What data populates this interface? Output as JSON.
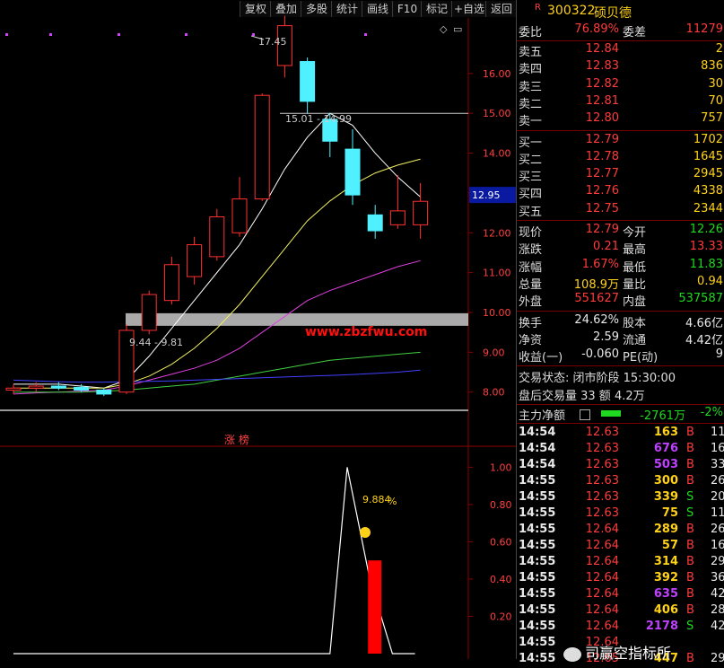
{
  "toolbar": [
    "复权",
    "叠加",
    "多股",
    "统计",
    "画线",
    "F10",
    "标记",
    "+自选",
    "返回"
  ],
  "header": {
    "badge": "R",
    "code": "300322",
    "name": "硕贝德"
  },
  "chart": {
    "price_axis": [
      "16.00",
      "15.00",
      "14.00",
      "13.00",
      "12.00",
      "11.00",
      "10.00",
      "9.00",
      "8.00"
    ],
    "current_price_tag": "12.95",
    "annotations": {
      "high": "17.45",
      "range1": "15.01 - 14.99",
      "range2": "9.44 - 9.81"
    },
    "watermark": "www.zbzfwu.com",
    "sub_title": "涨 榜",
    "sub_axis": [
      "1.00",
      "0.80",
      "0.60",
      "0.40",
      "0.20"
    ],
    "sub_value": "9.884",
    "sub_value_suffix": "%",
    "colors": {
      "up": "#ff3030",
      "down": "#4ff0ff",
      "ma5": "#ffffff",
      "ma10": "#f0f060",
      "ma20": "#e040e0",
      "ma60": "#40d040",
      "ma120": "#4040ff"
    }
  },
  "chart_data": {
    "type": "candlestick",
    "candles": [
      {
        "o": 8.05,
        "h": 8.2,
        "l": 7.95,
        "c": 8.1
      },
      {
        "o": 8.1,
        "h": 8.25,
        "l": 8.0,
        "c": 8.15
      },
      {
        "o": 8.15,
        "h": 8.25,
        "l": 8.05,
        "c": 8.1
      },
      {
        "o": 8.12,
        "h": 8.2,
        "l": 8.0,
        "c": 8.05
      },
      {
        "o": 8.05,
        "h": 8.1,
        "l": 7.9,
        "c": 7.95
      },
      {
        "o": 8.0,
        "h": 9.7,
        "l": 7.95,
        "c": 9.55
      },
      {
        "o": 9.55,
        "h": 10.55,
        "l": 9.45,
        "c": 10.45
      },
      {
        "o": 10.3,
        "h": 11.4,
        "l": 10.2,
        "c": 11.2
      },
      {
        "o": 10.9,
        "h": 11.9,
        "l": 10.7,
        "c": 11.7
      },
      {
        "o": 11.4,
        "h": 12.6,
        "l": 11.3,
        "c": 12.4
      },
      {
        "o": 12.0,
        "h": 13.4,
        "l": 11.9,
        "c": 12.85
      },
      {
        "o": 12.85,
        "h": 15.5,
        "l": 12.8,
        "c": 15.45
      },
      {
        "o": 16.2,
        "h": 17.45,
        "l": 15.9,
        "c": 17.2
      },
      {
        "o": 16.3,
        "h": 16.4,
        "l": 15.0,
        "c": 15.3
      },
      {
        "o": 14.85,
        "h": 15.01,
        "l": 13.9,
        "c": 14.3
      },
      {
        "o": 14.1,
        "h": 14.6,
        "l": 12.7,
        "c": 12.95
      },
      {
        "o": 12.45,
        "h": 12.7,
        "l": 11.85,
        "c": 12.05
      },
      {
        "o": 12.2,
        "h": 13.45,
        "l": 12.1,
        "c": 12.55
      },
      {
        "o": 12.2,
        "h": 13.25,
        "l": 11.85,
        "c": 12.79
      }
    ],
    "ma": {
      "ma5": [
        8.2,
        8.2,
        8.2,
        8.15,
        8.1,
        8.3,
        8.9,
        9.6,
        10.3,
        11.0,
        11.7,
        12.6,
        13.6,
        14.4,
        15.0,
        14.7,
        14.0,
        13.4,
        12.9
      ],
      "ma10": [
        8.1,
        8.1,
        8.1,
        8.1,
        8.1,
        8.2,
        8.4,
        8.7,
        9.1,
        9.6,
        10.2,
        10.9,
        11.6,
        12.3,
        12.8,
        13.2,
        13.5,
        13.7,
        13.85
      ],
      "ma20": [
        7.95,
        7.98,
        8.0,
        8.02,
        8.05,
        8.15,
        8.3,
        8.45,
        8.6,
        8.8,
        9.1,
        9.5,
        9.9,
        10.3,
        10.55,
        10.75,
        10.95,
        11.15,
        11.3
      ],
      "ma60": [
        8.0,
        8.0,
        8.0,
        8.0,
        8.02,
        8.05,
        8.1,
        8.15,
        8.2,
        8.3,
        8.4,
        8.5,
        8.6,
        8.7,
        8.8,
        8.85,
        8.9,
        8.95,
        9.0
      ],
      "ma120": [
        8.3,
        8.28,
        8.26,
        8.25,
        8.25,
        8.26,
        8.27,
        8.28,
        8.3,
        8.32,
        8.34,
        8.36,
        8.38,
        8.4,
        8.42,
        8.44,
        8.47,
        8.5,
        8.55
      ]
    },
    "ylim": [
      7.7,
      17.8
    ],
    "sub": {
      "type": "line+bar",
      "line": [
        0,
        0,
        0,
        0,
        0,
        0,
        0,
        0,
        0,
        0,
        0,
        0,
        0,
        0,
        0,
        1.0,
        0.4,
        0,
        0
      ],
      "bar_index": 16,
      "bar_value": 0.5,
      "ylim": [
        0,
        1.05
      ]
    }
  },
  "quote": {
    "weibi": {
      "label": "委比",
      "value": "76.89%",
      "label2": "委差",
      "value2": "11279"
    },
    "sells": [
      {
        "label": "卖五",
        "price": "12.84",
        "vol": "2"
      },
      {
        "label": "卖四",
        "price": "12.83",
        "vol": "836"
      },
      {
        "label": "卖三",
        "price": "12.82",
        "vol": "30"
      },
      {
        "label": "卖二",
        "price": "12.81",
        "vol": "70"
      },
      {
        "label": "卖一",
        "price": "12.80",
        "vol": "757"
      }
    ],
    "buys": [
      {
        "label": "买一",
        "price": "12.79",
        "vol": "1702"
      },
      {
        "label": "买二",
        "price": "12.78",
        "vol": "1645"
      },
      {
        "label": "买三",
        "price": "12.77",
        "vol": "2945"
      },
      {
        "label": "买四",
        "price": "12.76",
        "vol": "4338"
      },
      {
        "label": "买五",
        "price": "12.75",
        "vol": "2344"
      }
    ],
    "stats": [
      {
        "l1": "现价",
        "v1": "12.79",
        "c1": "red",
        "l2": "今开",
        "v2": "12.26",
        "c2": "green"
      },
      {
        "l1": "涨跌",
        "v1": "0.21",
        "c1": "red",
        "l2": "最高",
        "v2": "13.33",
        "c2": "red"
      },
      {
        "l1": "涨幅",
        "v1": "1.67%",
        "c1": "red",
        "l2": "最低",
        "v2": "11.83",
        "c2": "green"
      },
      {
        "l1": "总量",
        "v1": "108.9万",
        "c1": "yellow",
        "l2": "量比",
        "v2": "0.94",
        "c2": "yellow"
      },
      {
        "l1": "外盘",
        "v1": "551627",
        "c1": "red",
        "l2": "内盘",
        "v2": "537587",
        "c2": "green"
      }
    ],
    "stats2": [
      {
        "l1": "换手",
        "v1": "24.62%",
        "l2": "股本",
        "v2": "4.66亿"
      },
      {
        "l1": "净资",
        "v1": "2.59",
        "l2": "流通",
        "v2": "4.42亿"
      },
      {
        "l1": "收益(一)",
        "v1": "-0.060",
        "l2": "PE(动)",
        "v2": "9"
      }
    ],
    "trade_status": "交易状态: 闭市阶段 15:30:00",
    "after_hours": "盘后交易量 33 额 4.2万",
    "mainflow": {
      "label": "主力净额",
      "value": "-2761万",
      "pct": "-2%"
    }
  },
  "ticks": [
    {
      "t": "14:54",
      "p": "12.63",
      "v": "163",
      "s": "B",
      "n": "11",
      "vc": "yellow"
    },
    {
      "t": "14:54",
      "p": "12.63",
      "v": "676",
      "s": "B",
      "n": "16",
      "vc": "purple"
    },
    {
      "t": "14:54",
      "p": "12.63",
      "v": "503",
      "s": "B",
      "n": "33",
      "vc": "purple"
    },
    {
      "t": "14:55",
      "p": "12.63",
      "v": "300",
      "s": "B",
      "n": "26",
      "vc": "yellow"
    },
    {
      "t": "14:55",
      "p": "12.63",
      "v": "339",
      "s": "S",
      "n": "20",
      "vc": "yellow"
    },
    {
      "t": "14:55",
      "p": "12.63",
      "v": "75",
      "s": "S",
      "n": "11",
      "vc": "yellow"
    },
    {
      "t": "14:55",
      "p": "12.64",
      "v": "289",
      "s": "B",
      "n": "26",
      "vc": "yellow"
    },
    {
      "t": "14:55",
      "p": "12.64",
      "v": "57",
      "s": "B",
      "n": "16",
      "vc": "yellow"
    },
    {
      "t": "14:55",
      "p": "12.64",
      "v": "314",
      "s": "B",
      "n": "29",
      "vc": "yellow"
    },
    {
      "t": "14:55",
      "p": "12.64",
      "v": "392",
      "s": "B",
      "n": "36",
      "vc": "yellow"
    },
    {
      "t": "14:55",
      "p": "12.64",
      "v": "635",
      "s": "B",
      "n": "42",
      "vc": "purple"
    },
    {
      "t": "14:55",
      "p": "12.64",
      "v": "406",
      "s": "B",
      "n": "28",
      "vc": "yellow"
    },
    {
      "t": "14:55",
      "p": "12.64",
      "v": "2178",
      "s": "S",
      "n": "42",
      "vc": "purple"
    },
    {
      "t": "14:55",
      "p": "12.64",
      "v": "",
      "s": "",
      "n": "",
      "vc": "yellow"
    },
    {
      "t": "14:55",
      "p": "12.65",
      "v": "447",
      "s": "B",
      "n": "29",
      "vc": "yellow"
    }
  ],
  "overlay_logo": "司赢空指标所"
}
